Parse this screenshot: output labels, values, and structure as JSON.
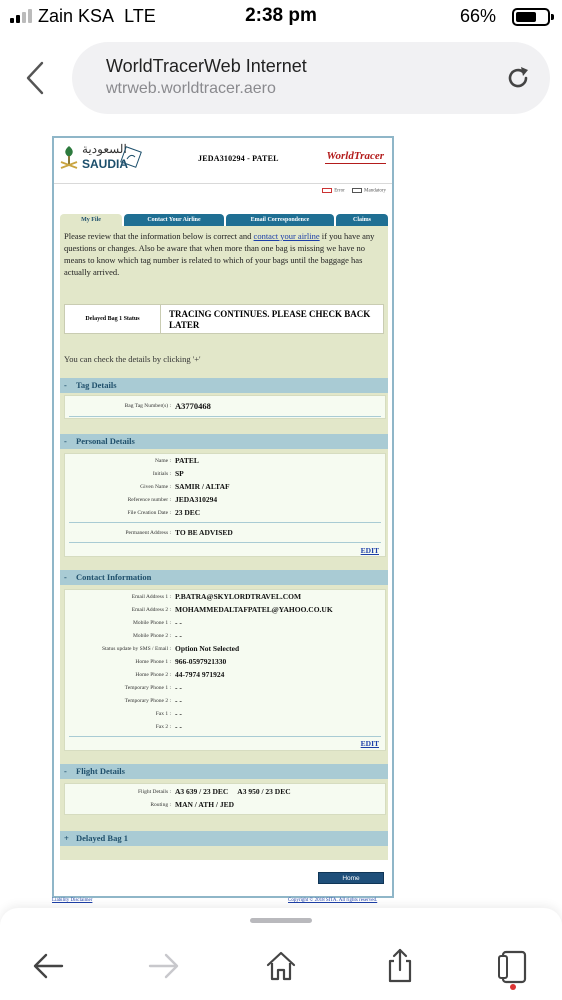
{
  "status_bar": {
    "carrier": "Zain KSA",
    "network": "LTE",
    "time": "2:38 pm",
    "battery": "66%"
  },
  "browser": {
    "page_title": "WorldTracerWeb Internet",
    "domain": "wtrweb.worldtracer.aero",
    "back_icon": "chevron-left-icon",
    "reload_icon": "reload-icon"
  },
  "header": {
    "airline_arabic": "السعودية",
    "airline_name": "SAUDIA",
    "file_ref": "JEDA310294 - PATEL",
    "brand": "WorldTracer"
  },
  "legend": {
    "error": "Error",
    "mandatory": "Mandatory"
  },
  "tabs": [
    {
      "label": "My File"
    },
    {
      "label": "Contact Your Airline"
    },
    {
      "label": "Email Correspondence"
    },
    {
      "label": "Claims"
    }
  ],
  "intro": {
    "part1": "Please review that the information below is correct and ",
    "link": "contact your airline",
    "part2": " if you have any questions or changes. Also be aware that when more than one bag is missing we have no means to know which tag number is related to which of your bags until the baggage has actually arrived."
  },
  "status": {
    "label": "Delayed Bag 1 Status",
    "value": "TRACING CONTINUES. PLEASE CHECK BACK LATER"
  },
  "hint": "You can check the details by clicking '+'",
  "sections": {
    "tag": {
      "toggle": "-",
      "title": "Tag Details",
      "rows": [
        {
          "key": "Bag Tag Number(s) :",
          "value": "A3770468"
        }
      ]
    },
    "personal": {
      "toggle": "-",
      "title": "Personal Details",
      "rows": [
        {
          "key": "Name :",
          "value": "PATEL"
        },
        {
          "key": "Initials :",
          "value": "SP"
        },
        {
          "key": "Given Name :",
          "value": "SAMIR / ALTAF"
        },
        {
          "key": "Reference number :",
          "value": "JEDA310294"
        },
        {
          "key": "File Creation Date :",
          "value": "23 DEC"
        }
      ],
      "address_key": "Permanent Address :",
      "address_value": "TO BE ADVISED",
      "edit": "EDIT"
    },
    "contact": {
      "toggle": "-",
      "title": "Contact Information",
      "rows": [
        {
          "key": "Email Address 1 :",
          "value": "P.BATRA@SKYLORDTRAVEL.COM"
        },
        {
          "key": "Email Address 2 :",
          "value": "MOHAMMEDALTAFPATEL@YAHOO.CO.UK"
        },
        {
          "key": "Mobile Phone 1 :",
          "value": "- -"
        },
        {
          "key": "Mobile Phone 2 :",
          "value": "- -"
        },
        {
          "key": "Status update by SMS / Email :",
          "value": "Option Not Selected"
        },
        {
          "key": "Home Phone 1 :",
          "value": "966-0597921330"
        },
        {
          "key": "Home Phone 2 :",
          "value": "44-7974 971924"
        },
        {
          "key": "Temporary Phone 1 :",
          "value": "- -"
        },
        {
          "key": "Temporary Phone 2 :",
          "value": "- -"
        },
        {
          "key": "Fax 1 :",
          "value": "- -"
        },
        {
          "key": "Fax 2 :",
          "value": "- -"
        }
      ],
      "edit": "EDIT"
    },
    "flight": {
      "toggle": "-",
      "title": "Flight Details",
      "rows": [
        {
          "key": "Flight Details :",
          "value": "A3 639 / 23 DEC     A3 950 / 23 DEC"
        },
        {
          "key": "Routing :",
          "value": "MAN / ATH / JED"
        }
      ]
    },
    "delayed": {
      "toggle": "+",
      "title": "Delayed Bag 1"
    }
  },
  "home_button": "Home",
  "footer": {
    "left": "Liability Disclaimer",
    "right": "Copyright © 2018 SITA. All rights reserved."
  },
  "toolbar": {
    "icons": [
      "arrow-left-icon",
      "arrow-right-icon",
      "home-icon",
      "share-icon",
      "tabs-icon"
    ]
  },
  "colors": {
    "tab_blue": "#1f6f93",
    "section_head": "#a9cbd4",
    "panel_bg": "#e2e7c9",
    "link": "#1d3fa8",
    "brand_red": "#b31b1b"
  }
}
